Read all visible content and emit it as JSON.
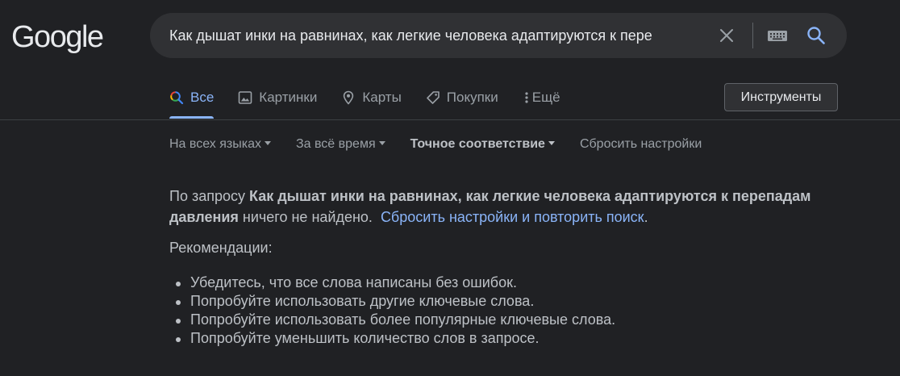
{
  "header": {
    "logo": "Google",
    "search": {
      "value": "Как дышат инки на равнинах, как легкие человека адаптируются к пере",
      "clear_icon": "close-icon",
      "keyboard_icon": "keyboard-icon",
      "search_icon": "search-icon"
    }
  },
  "tabs": [
    {
      "label": "Все",
      "icon": "search-icon",
      "active": true
    },
    {
      "label": "Картинки",
      "icon": "image-icon"
    },
    {
      "label": "Карты",
      "icon": "map-pin-icon"
    },
    {
      "label": "Покупки",
      "icon": "tag-icon"
    },
    {
      "label": "Ещё",
      "icon": "more-vert-icon"
    }
  ],
  "tools_label": "Инструменты",
  "filters": [
    {
      "label": "На всех языках",
      "dropdown": true
    },
    {
      "label": "За всё время",
      "dropdown": true
    },
    {
      "label": "Точное соответствие",
      "dropdown": true,
      "bold": true
    },
    {
      "label": "Сбросить настройки",
      "dropdown": false
    }
  ],
  "result": {
    "prefix": "По запросу ",
    "query": "Как дышат инки на равнинах, как легкие человека адаптируются к перепадам давления",
    "suffix": " ничего не найдено.",
    "reset_link": "Сбросить настройки и повторить поиск",
    "reset_link_end": "."
  },
  "recommendations": {
    "heading": "Рекомендации:",
    "items": [
      "Убедитесь, что все слова написаны без ошибок.",
      "Попробуйте использовать другие ключевые слова.",
      "Попробуйте использовать более популярные ключевые слова.",
      "Попробуйте уменьшить количество слов в запросе."
    ]
  },
  "colors": {
    "background": "#202124",
    "searchbox": "#303134",
    "link": "#8ab4f8",
    "text": "#bdc1c6",
    "muted": "#9aa0a6"
  }
}
